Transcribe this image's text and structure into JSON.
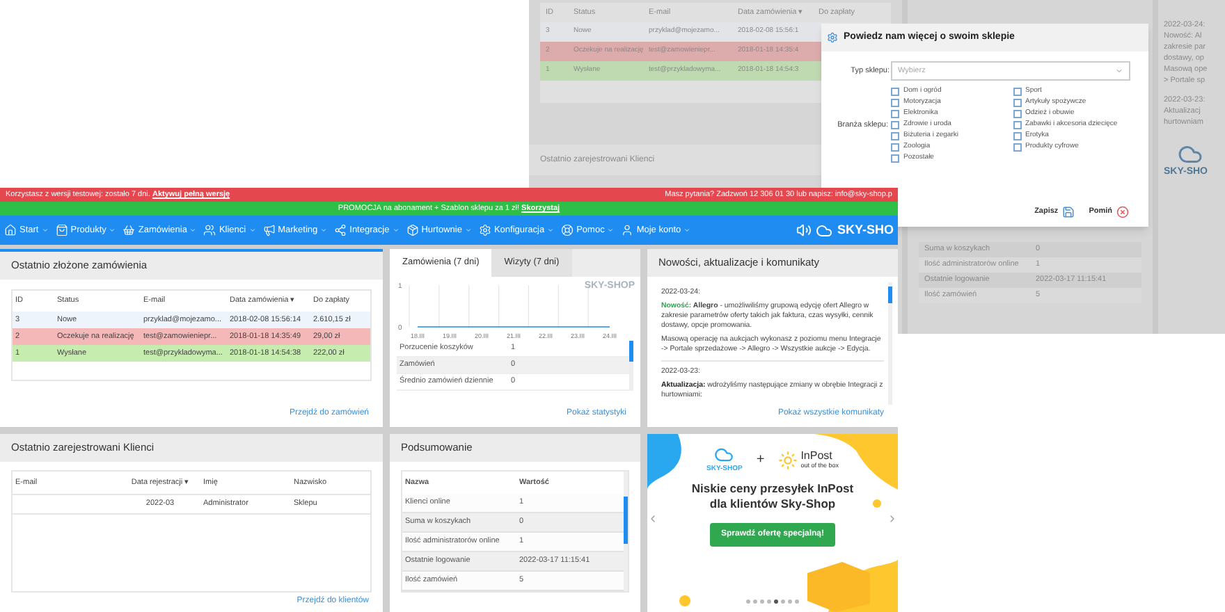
{
  "background_screen": {
    "orders_table": {
      "columns": [
        "ID",
        "Status",
        "E-mail",
        "Data zamówienia ▾",
        "Do zapłaty"
      ],
      "rows": [
        {
          "cells": [
            "3",
            "Nowe",
            "przyklad@mojezamo...",
            "2018-02-08 15:56:1"
          ],
          "color": "#e2e4e8"
        },
        {
          "cells": [
            "2",
            "Oczekuje na realizację",
            "test@zamowieniepr...",
            "2018-01-18 14:35:4"
          ],
          "color": "#dcabab"
        },
        {
          "cells": [
            "1",
            "Wysłane",
            "test@przykladowyma...",
            "2018-01-18 14:54:3"
          ],
          "color": "#bfd9b1"
        }
      ]
    },
    "clients_header": "Ostatnio zarejestrowani Klienci",
    "news_lines": [
      "2022-03-24:",
      "Nowość: Al",
      "zakresie par",
      "dostawy, op",
      "Masową ope",
      "> Portale sp",
      "2022-03-23:",
      "Aktualizacj",
      "hurtowniam"
    ],
    "logo": "SKY-SHO",
    "summary_rows": [
      {
        "name": "Suma w koszykach",
        "value": "0"
      },
      {
        "name": "Ilość administratorów online",
        "value": "1"
      },
      {
        "name": "Ostatnie logowanie",
        "value": "2022-03-17 11:15:41"
      },
      {
        "name": "Ilość zamówień",
        "value": "5"
      }
    ]
  },
  "dialog": {
    "title": "Powiedz nam więcej o swoim sklepie",
    "shop_type": {
      "label": "Typ sklepu:",
      "placeholder": "Wybierz"
    },
    "industry": {
      "label": "Branża sklepu:",
      "options": [
        {
          "label": "Dom i ogród",
          "checked": false
        },
        {
          "label": "Motoryzacja",
          "checked": false
        },
        {
          "label": "Elektronika",
          "checked": false
        },
        {
          "label": "Zdrowie i uroda",
          "checked": false
        },
        {
          "label": "Biżuteria i zegarki",
          "checked": false
        },
        {
          "label": "Zoologia",
          "checked": false
        },
        {
          "label": "Pozostałe",
          "checked": false
        },
        {
          "label": "Sport",
          "checked": false
        },
        {
          "label": "Artykuły spożywcze",
          "checked": false
        },
        {
          "label": "Odzież i obuwie",
          "checked": false
        },
        {
          "label": "Zabawki i akcesoria dziecięce",
          "checked": false
        },
        {
          "label": "Erotyka",
          "checked": false
        },
        {
          "label": "Produkty cyfrowe",
          "checked": false
        }
      ]
    },
    "buttons": [
      {
        "label": "Zapisz",
        "kind": "save"
      },
      {
        "label": "Pomiń",
        "kind": "skip"
      }
    ]
  },
  "trial_bar": {
    "text": "Korzystasz z wersji testowej: zostało 7 dni.",
    "link": "Aktywuj pełną wersję",
    "contact": "Masz pytania? Zadzwoń 12 306 01 30 lub napisz: info@sky-shop.p"
  },
  "promo_bar": {
    "text": "PROMOCJA na abonament + Szablon sklepu za 1 zł!",
    "link": "Skorzystaj"
  },
  "nav": {
    "items": [
      {
        "label": "Start"
      },
      {
        "label": "Produkty"
      },
      {
        "label": "Zamówienia"
      },
      {
        "label": "Klienci"
      },
      {
        "label": "Marketing"
      },
      {
        "label": "Integracje"
      },
      {
        "label": "Hurtownie"
      },
      {
        "label": "Konfiguracja"
      },
      {
        "label": "Pomoc"
      },
      {
        "label": "Moje konto"
      }
    ],
    "logo": "SKY-SHO"
  },
  "orders": {
    "title": "Ostatnio złożone zamówienia",
    "columns": [
      "ID",
      "Status",
      "E-mail",
      "Data zamówienia ▾",
      "Do zapłaty"
    ],
    "rows": [
      {
        "cells": [
          "3",
          "Nowe",
          "przyklad@mojezamo...",
          "2018-02-08 15:56:14",
          "2.610,15 zł"
        ],
        "color": "#eef4fb"
      },
      {
        "cells": [
          "2",
          "Oczekuje na realizację",
          "test@zamowieniepr...",
          "2018-01-18 14:35:49",
          "29,00 zł"
        ],
        "color": "#f5b8b8"
      },
      {
        "cells": [
          "1",
          "Wysłane",
          "test@przykladowyma...",
          "2018-01-18 14:54:38",
          "222,00 zł"
        ],
        "color": "#c6ecb0"
      }
    ],
    "link": "Przejdź do zamówień"
  },
  "stats": {
    "tabs": [
      {
        "label": "Zamówienia (7 dni)",
        "selected": true
      },
      {
        "label": "Wizyty (7 dni)",
        "selected": false
      }
    ],
    "chart_data": {
      "type": "line",
      "categories": [
        "18.III",
        "19.III",
        "20.III",
        "21.III",
        "22.III",
        "23.III",
        "24.III"
      ],
      "series": [
        {
          "color": "#1e88e5",
          "values": [
            0,
            0,
            0,
            0,
            0,
            0,
            0
          ]
        }
      ],
      "ylim": [
        0,
        1
      ],
      "yticks": [
        0,
        1
      ]
    },
    "chart_mark": "SKY-SHOP",
    "rows": [
      {
        "name": "Porzucenie koszyków",
        "value": "1"
      },
      {
        "name": "Zamówień",
        "value": "0"
      },
      {
        "name": "Średnio zamówień dziennie",
        "value": "0"
      }
    ],
    "link": "Pokaż statystyki"
  },
  "news": {
    "title": "Nowości, aktualizacje i komunikaty",
    "items": [
      {
        "date": "2022-03-24:",
        "label": "Nowość:",
        "color": "#2ea44f",
        "paragraphs": [
          "**Allegro** - umożliwiliśmy grupową edycję ofert Allegro w zakresie parametrów oferty takich jak faktura, czas wysyłki, cennik dostawy, opcje promowania.",
          "Masową operację na aukcjach wykonasz z poziomu menu Integracje -> Portale sprzedażowe -> Allegro -> Wszystkie aukcje -> Edycja."
        ]
      },
      {
        "date": "2022-03-23:",
        "label": "Aktualizacja:",
        "color": "#222222",
        "paragraphs": [
          "wdrożyliśmy następujące zmiany w obrębie Integracji z hurtowniami:"
        ]
      }
    ],
    "link": "Pokaż wszystkie komunikaty"
  },
  "clients": {
    "title": "Ostatnio zarejestrowani Klienci",
    "columns": [
      "E-mail",
      "Data rejestracji ▾",
      "Imię",
      "Nazwisko"
    ],
    "rows": [
      [
        "",
        "2022-03",
        "Administrator",
        "Sklepu"
      ]
    ],
    "link": "Przejdź do klientów"
  },
  "summary": {
    "title": "Podsumowanie",
    "columns": [
      "Nazwa",
      "Wartość"
    ],
    "rows": [
      {
        "name": "Klienci online",
        "value": "1"
      },
      {
        "name": "Suma w koszykach",
        "value": "0"
      },
      {
        "name": "Ilość administratorów online",
        "value": "1"
      },
      {
        "name": "Ostatnie logowanie",
        "value": "2022-03-17 11:15:41"
      },
      {
        "name": "Ilość zamówień",
        "value": "5"
      }
    ]
  },
  "ad": {
    "logo_left": "SKY-SHOP",
    "plus": "+",
    "logo_right": "InPost",
    "logo_right_sub": "out of the box",
    "headline": [
      "Niskie ceny przesyłek InPost",
      "dla klientów Sky-Shop"
    ],
    "button": "Sprawdź ofertę specjalną!",
    "dots": [
      {
        "selected": false
      },
      {
        "selected": false
      },
      {
        "selected": false
      },
      {
        "selected": false
      },
      {
        "selected": true
      },
      {
        "selected": false
      },
      {
        "selected": false
      },
      {
        "selected": false
      }
    ]
  }
}
